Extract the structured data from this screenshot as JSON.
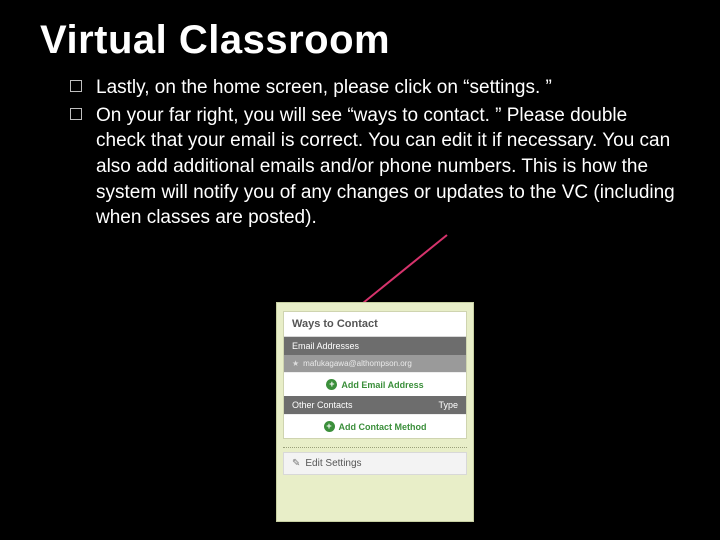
{
  "title": "Virtual Classroom",
  "bullets": [
    "Lastly, on the home screen, please click on “settings. ”",
    "On your far right, you will see “ways to contact. ”  Please double check that your email is correct.  You can edit it if necessary. You can also add additional emails and/or phone numbers.  This is how the system will notify you of any changes or updates to the VC (including when classes are posted)."
  ],
  "panel": {
    "header": "Ways to Contact",
    "section_email": "Email Addresses",
    "email_value": "mafukagawa@althompson.org",
    "add_email": "Add Email Address",
    "section_other": "Other Contacts",
    "section_type": "Type",
    "add_contact": "Add Contact Method",
    "edit": "Edit Settings"
  }
}
